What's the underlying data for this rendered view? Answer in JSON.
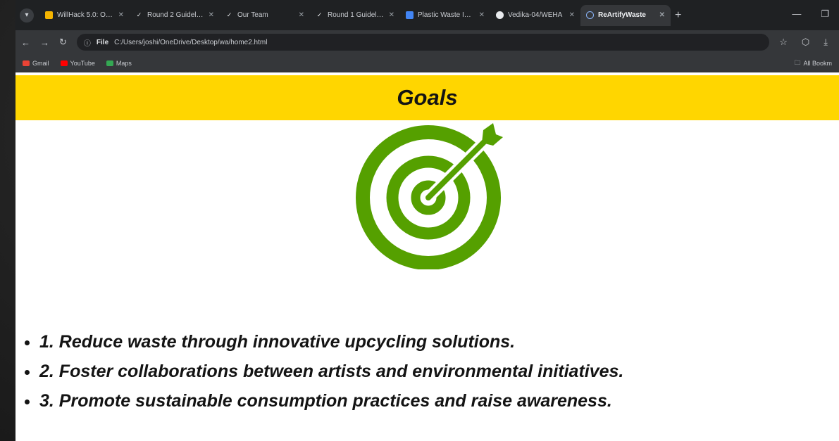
{
  "browser": {
    "tabs": [
      {
        "label": "WillHack 5.0: Onlin",
        "favicon_color": "#f4b400",
        "active": false
      },
      {
        "label": "Round 2 Guidelines",
        "favicon_color": "#9aa0a6",
        "active": false
      },
      {
        "label": "Our Team",
        "favicon_color": "#9aa0a6",
        "active": false
      },
      {
        "label": "Round 1 Guidelines",
        "favicon_color": "#9aa0a6",
        "active": false
      },
      {
        "label": "Plastic Waste Innov",
        "favicon_color": "#4285f4",
        "active": false
      },
      {
        "label": "Vedika-04/WEHA",
        "favicon_color": "#e8eaed",
        "active": false
      },
      {
        "label": "ReArtifyWaste",
        "favicon_color": "#8ab4f8",
        "active": true
      }
    ],
    "address": {
      "chip": "File",
      "url": "C:/Users/joshi/OneDrive/Desktop/wa/home2.html"
    },
    "bookmarks": [
      {
        "label": "Gmail",
        "color": "#ea4335"
      },
      {
        "label": "YouTube",
        "color": "#ff0000"
      },
      {
        "label": "Maps",
        "color": "#34a853"
      }
    ],
    "all_bookmarks": "All Bookm"
  },
  "page": {
    "title": "Goals",
    "banner_color": "#ffd600",
    "icon": "target-arrow-icon",
    "icon_color": "#55a000",
    "goals": [
      "1. Reduce waste through innovative upcycling solutions.",
      "2. Foster collaborations between artists and environmental initiatives.",
      "3. Promote sustainable consumption practices and raise awareness."
    ]
  }
}
